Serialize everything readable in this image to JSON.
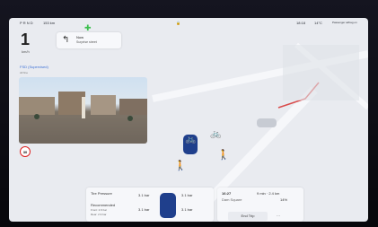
{
  "status": {
    "gear_indicator": "P R N D",
    "range": "153 km",
    "lock_icon": "lock-icon",
    "time": "18:18",
    "temperature": "14°C",
    "passenger_airbag": "Passenger airbag on"
  },
  "speed": {
    "value": "1",
    "unit": "km/h"
  },
  "navigation": {
    "line1": "Now",
    "line2": "Surprise street"
  },
  "autopilot": {
    "title": "FSD (Supervised)",
    "subtitle": "All fine"
  },
  "speed_limit_sign": "30",
  "tire_pressure": {
    "title": "Tire Pressure",
    "recommended_title": "Recommended",
    "recommended_front": "Front: 2.9 bar",
    "recommended_rear": "Rear: 2.9 bar",
    "front_left": "3.1 bar",
    "front_right": "3.1 bar",
    "rear_left": "3.1 bar",
    "rear_right": "3.1 bar"
  },
  "trip": {
    "time": "16:27",
    "eta_distance": "9 min · 2.4 km",
    "destination": "Dam Square",
    "battery": "14%",
    "end_trip_label": "End Trip",
    "more": "···"
  },
  "colors": {
    "accent": "#3b6fd6",
    "screen_bg": "#e9ebf0",
    "car_blue": "#1f3f8c"
  }
}
